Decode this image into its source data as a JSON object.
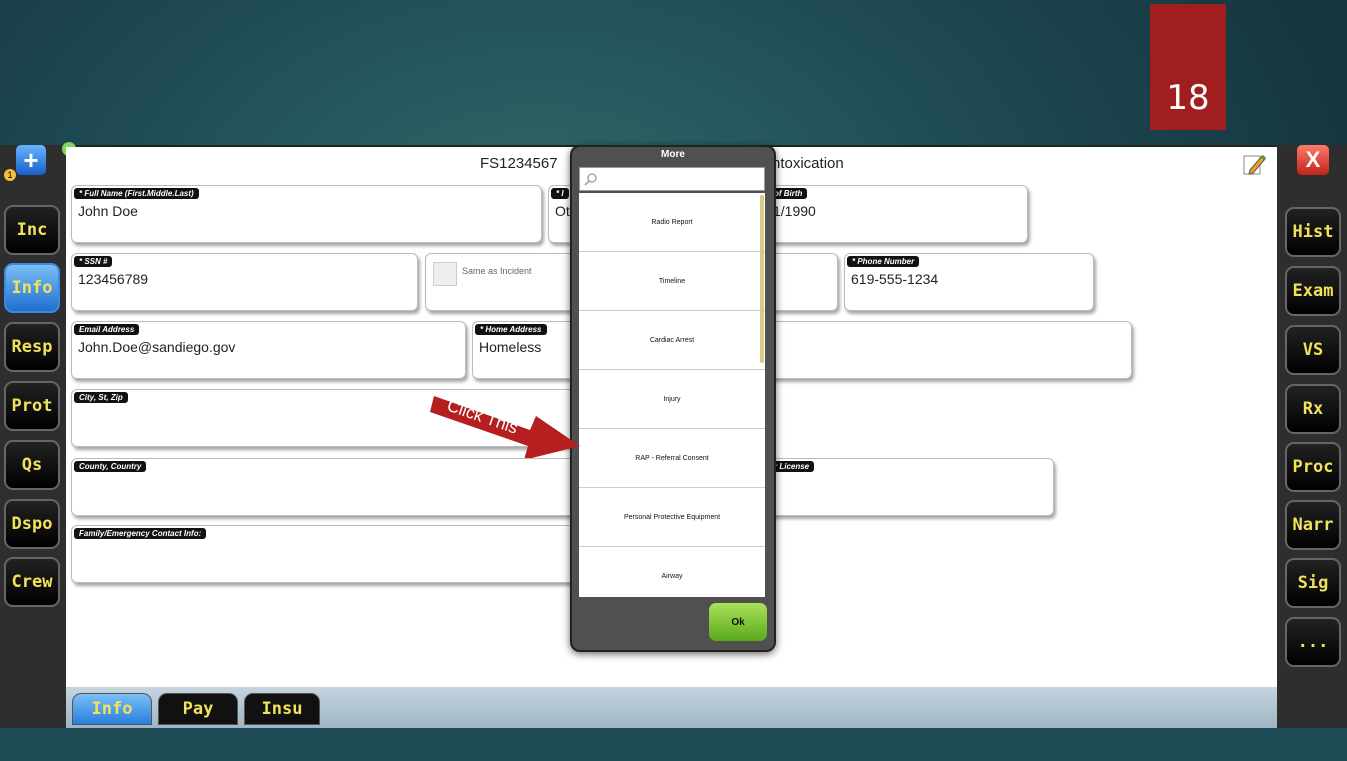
{
  "slide_number": "18",
  "header": {
    "title_left": "FS1234567",
    "title_right": "ntoxication"
  },
  "left_nav": [
    "Inc",
    "Info",
    "Resp",
    "Prot",
    "Qs",
    "Dspo",
    "Crew"
  ],
  "left_nav_active": "Info",
  "right_nav": [
    "Hist",
    "Exam",
    "VS",
    "Rx",
    "Proc",
    "Narr",
    "Sig",
    "..."
  ],
  "warning_count": "1",
  "close_label": "X",
  "plus_label": "+",
  "fields": {
    "full_name": {
      "label": "* Full Name (First.Middle.Last)",
      "value": "John  Doe"
    },
    "second": {
      "label": "* I",
      "value": "Ot"
    },
    "dob": {
      "label": "of Birth",
      "value": "1/1990"
    },
    "ssn": {
      "label": "* SSN #",
      "value": "123456789"
    },
    "same_as_incident": {
      "label": "Same as Incident"
    },
    "phone": {
      "label": "* Phone Number",
      "value": "619-555-1234"
    },
    "email": {
      "label": "Email Address",
      "value": "John.Doe@sandiego.gov"
    },
    "home_address": {
      "label": "* Home Address",
      "value": "Homeless"
    },
    "city": {
      "label": "City, St, Zip",
      "value": ""
    },
    "county": {
      "label": "County, Country",
      "value": ""
    },
    "license": {
      "label": "r License",
      "value": ""
    },
    "family": {
      "label": "Family/Emergency Contact Info:",
      "value": ""
    }
  },
  "bottom_tabs": [
    "Info",
    "Pay",
    "Insu"
  ],
  "bottom_tab_active": "Info",
  "more_dialog": {
    "title": "More",
    "search_placeholder": "",
    "items": [
      "Radio Report",
      "Timeline",
      "Cardiac Arrest",
      "Injury",
      "RAP - Referral Consent",
      "Personal Protective Equipment",
      "Airway"
    ],
    "ok_label": "Ok"
  },
  "callout": {
    "text": "Click This",
    "color": "#b51f1f"
  },
  "icons": [
    "plus-icon",
    "close-icon",
    "edit-icon",
    "search-icon"
  ]
}
